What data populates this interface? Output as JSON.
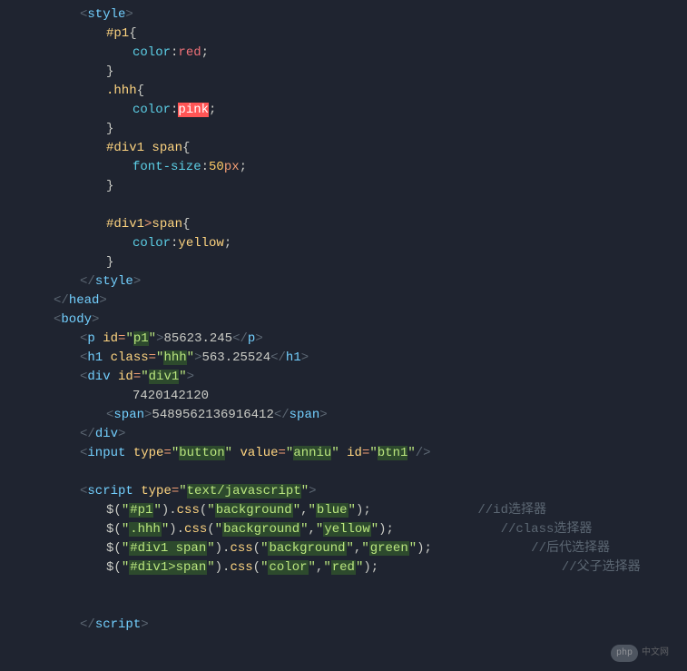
{
  "code": {
    "l1_tag": "style",
    "l2_sel": "#p1",
    "l3_prop": "color",
    "l3_val": "red",
    "l5_sel": ".hhh",
    "l6_prop": "color",
    "l6_val": "pink",
    "l8_sel1": "#div1",
    "l8_sel2": "span",
    "l9_prop": "font-size",
    "l9_num": "50",
    "l9_unit": "px",
    "l11_sel1": "#div1",
    "l11_sel2": "span",
    "l12_prop": "color",
    "l12_val": "yellow",
    "l14_tag": "style",
    "l15_tag": "head",
    "l16_tag": "body",
    "l17_tag": "p",
    "l17_attr": "id",
    "l17_val": "p1",
    "l17_txt": "85623.245",
    "l18_tag": "h1",
    "l18_attr": "class",
    "l18_val": "hhh",
    "l18_txt": "563.25524",
    "l19_tag": "div",
    "l19_attr": "id",
    "l19_val": "div1",
    "l20_txt": "7420142120",
    "l21_tag": "span",
    "l21_txt": "5489562136916412",
    "l22_tag": "div",
    "l23_tag": "input",
    "l23_a1": "type",
    "l23_v1": "button",
    "l23_a2": "value",
    "l23_v2": "anniu",
    "l23_a3": "id",
    "l23_v3": "btn1",
    "l25_tag": "script",
    "l25_attr": "type",
    "l25_val": "text/javascript",
    "l26_sel": "#p1",
    "l26_m": "css",
    "l26_p": "background",
    "l26_v": "blue",
    "l26_c": "//id选择器",
    "l27_sel": ".hhh",
    "l27_m": "css",
    "l27_p": "background",
    "l27_v": "yellow",
    "l27_c": "//class选择器",
    "l28_sel": "#div1 span",
    "l28_m": "css",
    "l28_p": "background",
    "l28_v": "green",
    "l28_c": "//后代选择器",
    "l29_sel": "#div1>span",
    "l29_m": "css",
    "l29_p": "color",
    "l29_v": "red",
    "l29_c": "//父子选择器",
    "l31_tag": "script"
  },
  "watermark": {
    "logo": "php",
    "text": "中文网"
  }
}
